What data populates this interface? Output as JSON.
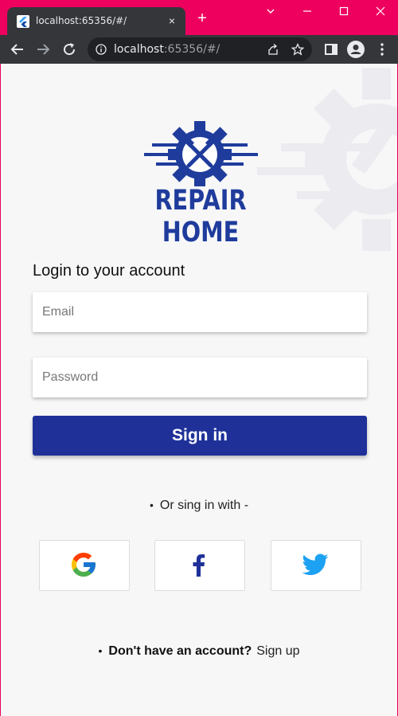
{
  "browser": {
    "tab_title": "localhost:65356/#/",
    "tab_close": "×",
    "new_tab": "+",
    "url_host": "localhost",
    "url_rest": ":65356/#/"
  },
  "logo": {
    "text": "REPAIR HOME"
  },
  "login": {
    "heading": "Login to your account",
    "email_placeholder": "Email",
    "password_placeholder": "Password",
    "signin_label": "Sign in",
    "bullet": "•",
    "or_text": "Or sing in with -"
  },
  "social": [
    {
      "name": "google-icon"
    },
    {
      "name": "facebook-icon"
    },
    {
      "name": "twitter-icon"
    }
  ],
  "footer": {
    "bullet": "•",
    "question": "Don't have an account?",
    "signup_label": "Sign up"
  },
  "colors": {
    "brand": "#1f3199",
    "frame": "#ee005f",
    "page_bg": "#f7f7f8"
  }
}
